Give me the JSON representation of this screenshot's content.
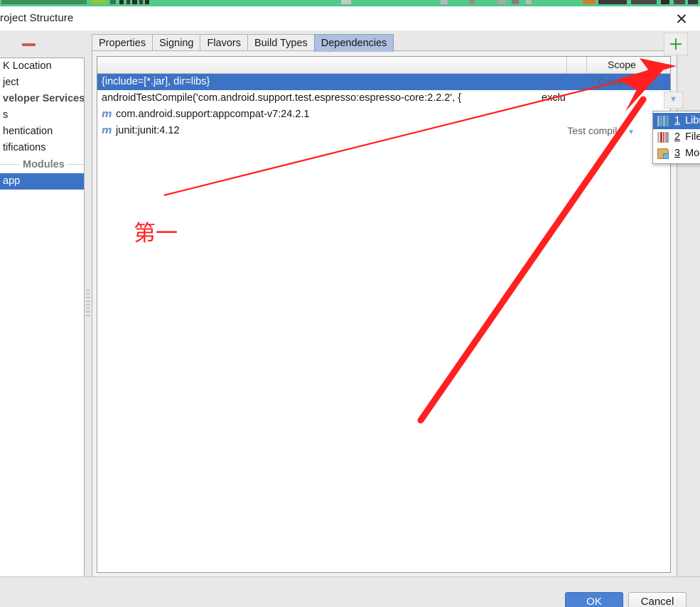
{
  "window": {
    "title": "roject Structure",
    "close_icon": "close-icon"
  },
  "sidebar": {
    "collapse_icon": "minus-icon",
    "items": [
      {
        "label": "K Location",
        "selected": false,
        "type": "item"
      },
      {
        "label": "ject",
        "selected": false,
        "type": "item"
      },
      {
        "label": "veloper Services",
        "selected": false,
        "type": "group"
      },
      {
        "label": "s",
        "selected": false,
        "type": "item"
      },
      {
        "label": "hentication",
        "selected": false,
        "type": "item"
      },
      {
        "label": "tifications",
        "selected": false,
        "type": "item"
      },
      {
        "label": "Modules",
        "selected": false,
        "type": "separator"
      },
      {
        "label": "app",
        "selected": true,
        "type": "item"
      }
    ]
  },
  "tabs": [
    {
      "label": "Properties",
      "active": false
    },
    {
      "label": "Signing",
      "active": false
    },
    {
      "label": "Flavors",
      "active": false
    },
    {
      "label": "Build Types",
      "active": false
    },
    {
      "label": "Dependencies",
      "active": true
    }
  ],
  "dependencies_table": {
    "header": {
      "scope_label": "Scope"
    },
    "add_button": {
      "label": "+",
      "icon": "plus-icon"
    },
    "rows": [
      {
        "icon": "",
        "text": "{include=[*.jar], dir=libs}",
        "extra": "",
        "scope": "Compile",
        "selected": true
      },
      {
        "icon": "",
        "text": "androidTestCompile('com.android.support.test.espresso:espresso-core:2.2.2', {",
        "extra": "exclu",
        "scope": "",
        "selected": false
      },
      {
        "icon": "m",
        "text": "com.android.support:appcompat-v7:24.2.1",
        "extra": "",
        "scope": "",
        "selected": false
      },
      {
        "icon": "m",
        "text": "junit:junit:4.12",
        "extra": "",
        "scope": "Test compile",
        "selected": false
      }
    ]
  },
  "popup_menu": {
    "items": [
      {
        "num": "1",
        "label": "Library dependency",
        "icon": "library-icon",
        "highlighted": true
      },
      {
        "num": "2",
        "label": "File dependency",
        "icon": "books-icon",
        "highlighted": false
      },
      {
        "num": "3",
        "label": "Module dependency",
        "icon": "folder-icon",
        "highlighted": false
      }
    ]
  },
  "footer": {
    "ok_label": "OK",
    "cancel_label": "Cancel"
  },
  "annotations": {
    "note_text": "第一",
    "accent_color": "#ff2020"
  },
  "colors": {
    "selection_blue": "#3d73c5",
    "active_tab": "#aebfdf",
    "plus_green": "#2fa82f",
    "ok_blue": "#4b82d3",
    "annotation_red": "#ff2020",
    "top_strip_green": "#53c98a"
  }
}
